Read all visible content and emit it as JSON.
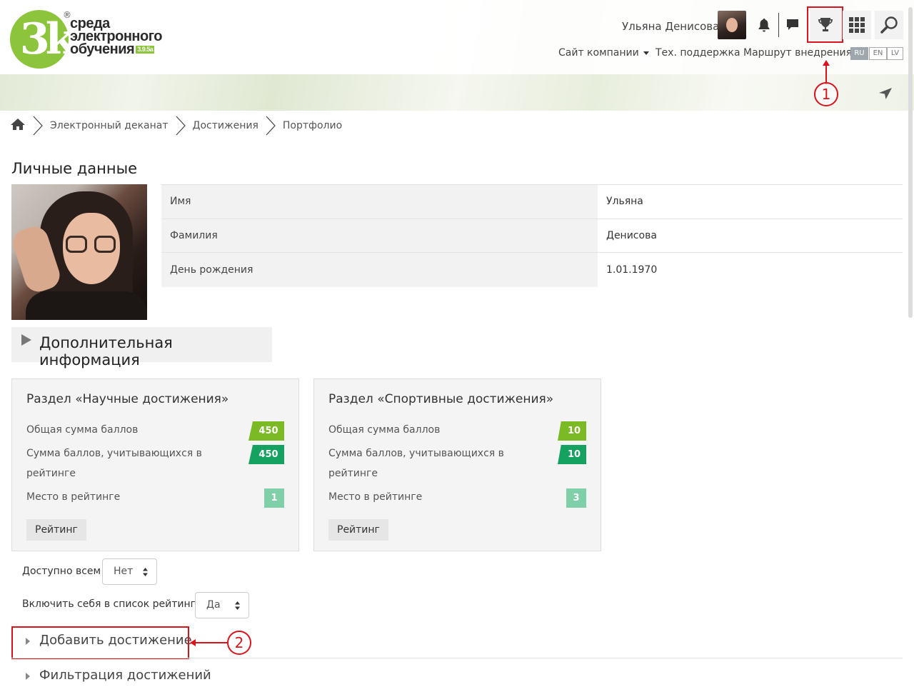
{
  "header": {
    "logo": {
      "mark": "3k",
      "line1": "среда",
      "line2": "электронного",
      "line3": "обучения",
      "version": "3.9.5a",
      "registered": "®"
    },
    "user_name": "Ульяна Денисова",
    "nav": {
      "company_site": "Сайт компании",
      "support": "Тех. поддержка",
      "route": "Маршрут внедрения"
    },
    "languages": [
      "RU",
      "EN",
      "LV"
    ],
    "active_language": "RU",
    "icons": [
      "bell-icon",
      "chat-icon",
      "trophy-icon",
      "apps-grid-icon",
      "search-icon",
      "send-icon"
    ]
  },
  "annotations": {
    "one": "1",
    "two": "2",
    "color": "#d9141c"
  },
  "breadcrumb": [
    "Электронный деканат",
    "Достижения",
    "Портфолио"
  ],
  "personal": {
    "title": "Личные данные",
    "rows": [
      {
        "key": "Имя",
        "value": "Ульяна"
      },
      {
        "key": "Фамилия",
        "value": "Денисова"
      },
      {
        "key": "День рождения",
        "value": "1.01.1970"
      }
    ]
  },
  "extra_info": "Дополнительная информация",
  "cards": [
    {
      "title": "Раздел «Научные достижения»",
      "total_label": "Общая сумма баллов",
      "total": "450",
      "rated_label_1": "Сумма баллов, учитывающихся в",
      "rated_label_2": "рейтинге",
      "rated": "450",
      "place_label": "Место в рейтинге",
      "place": "1",
      "button": "Рейтинг"
    },
    {
      "title": "Раздел «Спортивные достижения»",
      "total_label": "Общая сумма баллов",
      "total": "10",
      "rated_label_1": "Сумма баллов, учитывающихся в",
      "rated_label_2": "рейтинге",
      "rated": "10",
      "place_label": "Место в рейтинге",
      "place": "3",
      "button": "Рейтинг"
    }
  ],
  "form": {
    "available_label": "Доступно всем",
    "available_value": "Нет",
    "include_label": "Включить себя в список рейтинга",
    "include_value": "Да"
  },
  "sections": {
    "add": "Добавить достижение",
    "filter": "Фильтрация достижений"
  },
  "colors": {
    "brand_green": "#8cc43c",
    "badge_total": "#7cba25",
    "badge_rated": "#15a260",
    "badge_place": "#7fd0a8",
    "annotation_red": "#d9141c"
  }
}
